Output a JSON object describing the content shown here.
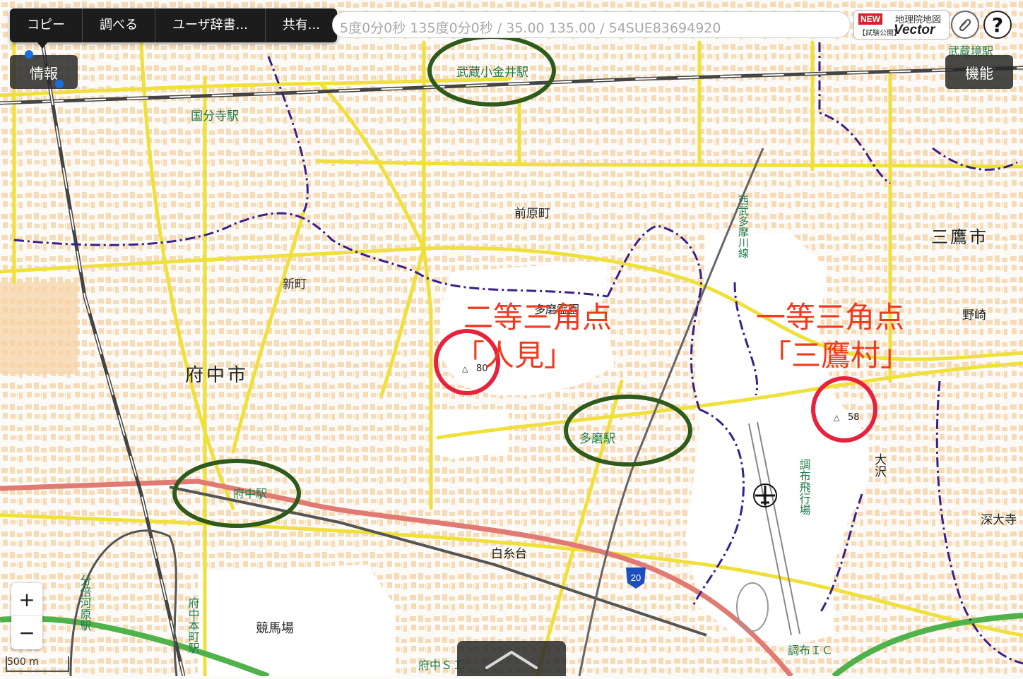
{
  "context_menu": {
    "items": [
      "コピー",
      "調べる",
      "ユーザ辞書...",
      "共有..."
    ]
  },
  "search": {
    "text": "5度0分0秒 135度0分0秒 / 35.00 135.00 / 54SUE83694920"
  },
  "badge": {
    "new_label": "NEW",
    "title": "地理院地図",
    "sub": "【試験公開】",
    "vector": "Vector"
  },
  "help_label": "?",
  "info_button": "情報",
  "function_button": "機能",
  "zoom": {
    "in": "+",
    "out": "−"
  },
  "scale_label": "500 m",
  "map": {
    "labels": {
      "musashi_koganei_st": "武蔵小金井駅",
      "kokubunji_st": "国分寺駅",
      "maehara": "前原町",
      "shinmachi": "新町",
      "tama_cemetery": "多磨霊園",
      "fuchu_city": "府中市",
      "tama_st": "多磨駅",
      "fuchu_st": "府中駅",
      "shiraitodai": "白糸台",
      "keibajo": "競馬場",
      "bubaigawara_st": "分倍河原駅",
      "fuchu_honmachi_st": "府中本町駅",
      "fuchu_si": "府中ＳＩ",
      "chofu_ic": "調布ＩＣ",
      "chofu_airport": "調布飛行場",
      "osawa": "大沢",
      "fukadaiji": "深大寺",
      "nozaki": "野崎",
      "mitaka_city": "三鷹市",
      "seibu_tamagawa_line": "西武多摩川線",
      "musashi_sakai_st": "武蔵境駅",
      "route_20": "20",
      "hitomi_elev": "80",
      "mitakamura_elev": "58",
      "triangle": "△"
    },
    "annotations": {
      "hitomi_title": "二等三角点",
      "hitomi_name": "「人見」",
      "mitaka_title": "一等三角点",
      "mitaka_name": "「三鷹村」"
    },
    "colors": {
      "background": "#fbfaf6",
      "building": "#f6d7b0",
      "road_major": "#efe03a",
      "road_minor": "#ffffff",
      "national_road": "#e07a72",
      "expressway": "#4fb24a",
      "boundary": "#3a1f8a",
      "railway": "#444444",
      "station_ring": "#2e5a1c",
      "triangulation_ring": "#e8223c",
      "annotation_text": "#f03a1e",
      "label_green": "#1f7a4a"
    }
  }
}
